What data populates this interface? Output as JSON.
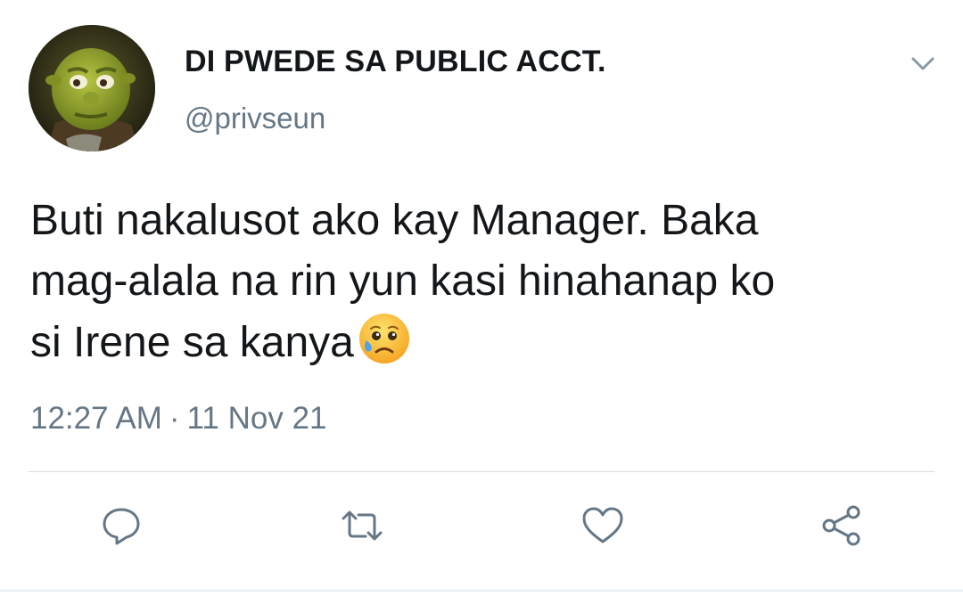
{
  "tweet": {
    "author": {
      "display_name": "DI PWEDE SA PUBLIC ACCT.",
      "handle": "@privseun",
      "avatar_icon": "shrek-avatar"
    },
    "text_lines": [
      "Buti nakalusot ako kay Manager. Baka",
      "mag-alala na rin yun kasi hinahanap ko",
      "si Irene sa kanya"
    ],
    "emoji": "sad-but-relieved-face-emoji",
    "time": "12:27 AM",
    "separator": "·",
    "date": "11 Nov 21",
    "menu_icon": "chevron-down-icon"
  },
  "actions": [
    {
      "name": "reply",
      "icon": "reply-icon"
    },
    {
      "name": "retweet",
      "icon": "retweet-icon"
    },
    {
      "name": "like",
      "icon": "heart-icon"
    },
    {
      "name": "share",
      "icon": "share-icon"
    }
  ],
  "colors": {
    "text": "#14171a",
    "secondary_text": "#657786",
    "icon": "#657786",
    "divider": "#d5dde3"
  }
}
